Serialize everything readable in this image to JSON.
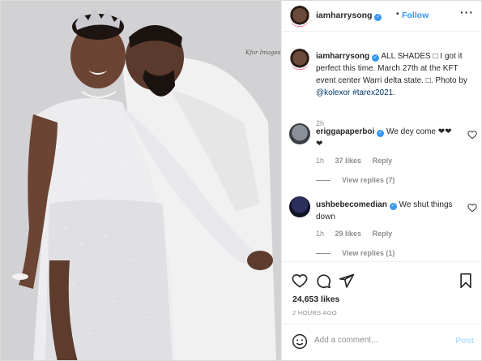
{
  "post": {
    "username": "iamharrysong",
    "follow_label": "Follow",
    "photo_watermark": "Kfor Images"
  },
  "caption": {
    "username": "iamharrysong",
    "text": "ALL SHADES □ I got it perfect this time. March 27th at the KFT event center Warri delta state. □. Photo by ",
    "mention": "@kolexor",
    "hashtag": "#tarex2021.",
    "time": "2h"
  },
  "comments": [
    {
      "username": "eriggapaperboi",
      "text": "We dey come ❤❤❤",
      "time": "1h",
      "likes": "37 likes",
      "reply_label": "Reply",
      "view_replies": "View replies (7)"
    },
    {
      "username": "ushbebecomedian",
      "text": "We shut things down",
      "time": "1h",
      "likes": "29 likes",
      "reply_label": "Reply",
      "view_replies": "View replies (1)"
    }
  ],
  "actions": {
    "likes": "24,653 likes",
    "posted": "2 HOURS AGO",
    "icons": [
      "heart-icon",
      "comment-icon",
      "share-icon",
      "bookmark-icon"
    ]
  },
  "add_comment": {
    "placeholder": "Add a comment...",
    "post_label": "Post"
  },
  "colors": {
    "accent": "#3897f0",
    "post_disabled": "#b2dffc",
    "muted": "#8e8e8e"
  }
}
